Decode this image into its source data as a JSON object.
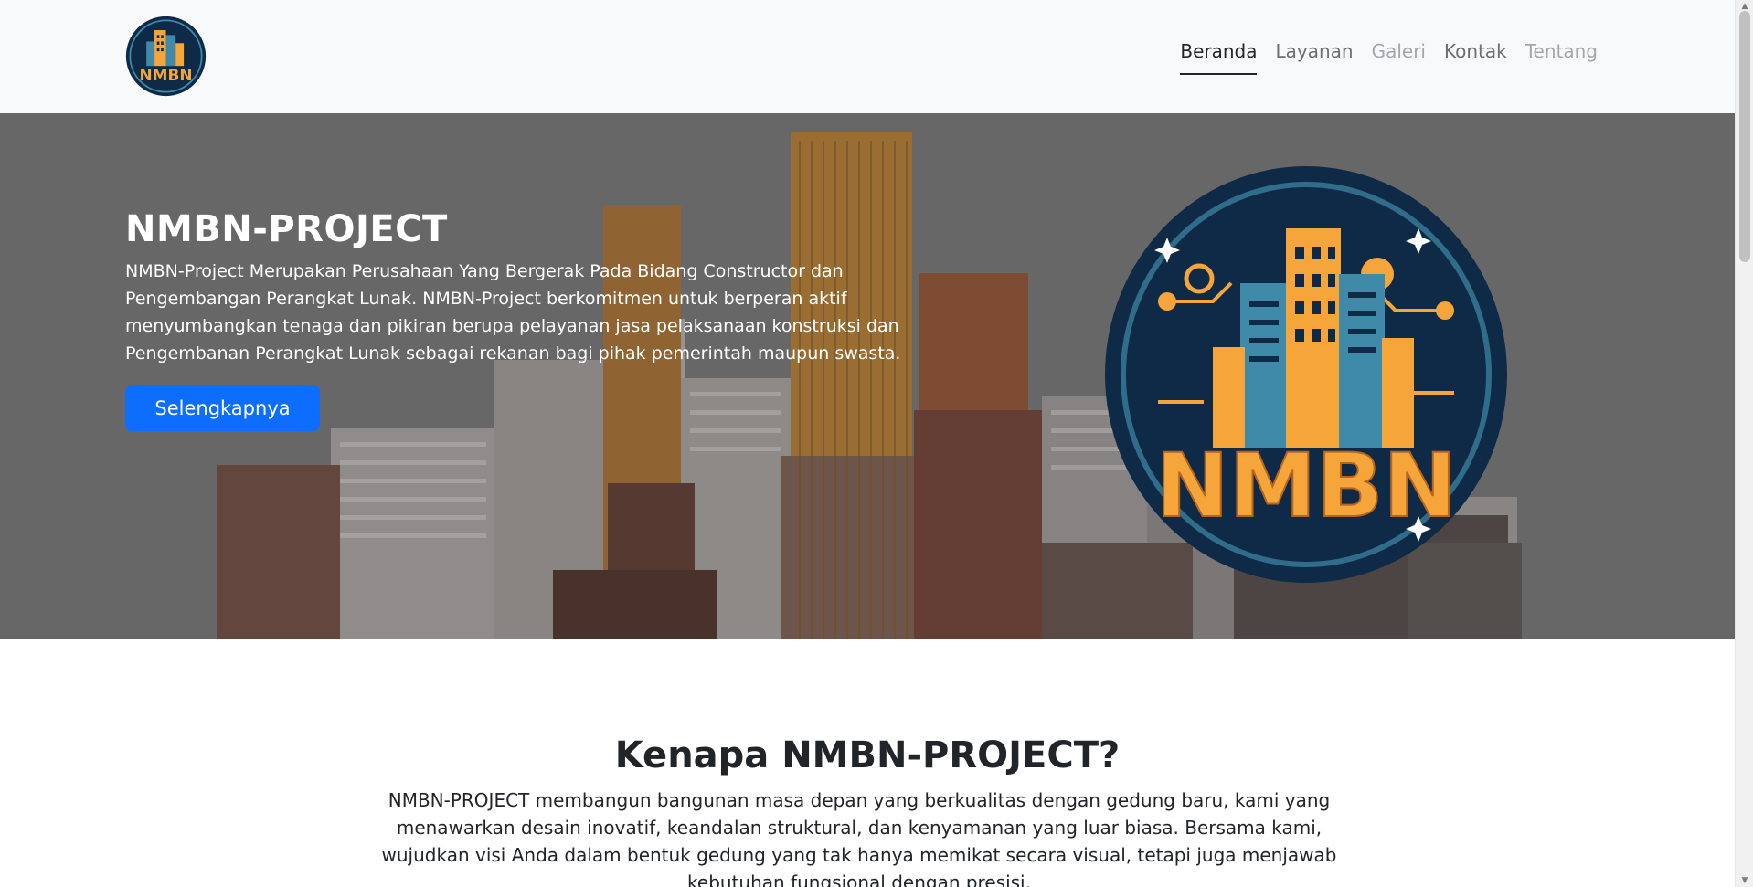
{
  "nav": {
    "logo_text": "NMBN",
    "links": [
      {
        "label": "Beranda",
        "state": "active"
      },
      {
        "label": "Layanan",
        "state": "normal"
      },
      {
        "label": "Galeri",
        "state": "dim"
      },
      {
        "label": "Kontak",
        "state": "normal"
      },
      {
        "label": "Tentang",
        "state": "dim"
      }
    ]
  },
  "hero": {
    "title": "NMBN-PROJECT",
    "description": "NMBN-Project Merupakan Perusahaan Yang Bergerak Pada Bidang Constructor dan Pengembangan Perangkat Lunak. NMBN-Project berkomitmen untuk berperan aktif menyumbangkan tenaga dan pikiran berupa pelayanan jasa pelaksanaan konstruksi dan Pengembanan Perangkat Lunak sebagai rekanan bagi pihak pemerintah maupun swasta.",
    "button_label": "Selengkapnya",
    "logo_text": "NMBN"
  },
  "why": {
    "title": "Kenapa NMBN-PROJECT?",
    "text": "NMBN-PROJECT membangun bangunan masa depan yang berkualitas dengan gedung baru, kami yang menawarkan desain inovatif, keandalan struktural, dan kenyamanan yang luar biasa. Bersama kami, wujudkan visi Anda dalam bentuk gedung yang tak hanya memikat secara visual, tetapi juga menjawab kebutuhan fungsional dengan presisi."
  },
  "colors": {
    "navbar_bg": "#f8f9fa",
    "primary_button": "#0d6efd",
    "logo_navy": "#0f2a47",
    "logo_orange": "#f5a53a",
    "logo_teal": "#3f8aa8"
  },
  "icons": {
    "brand": "nmbn-logo-icon",
    "hero_logo": "nmbn-emblem-icon"
  }
}
